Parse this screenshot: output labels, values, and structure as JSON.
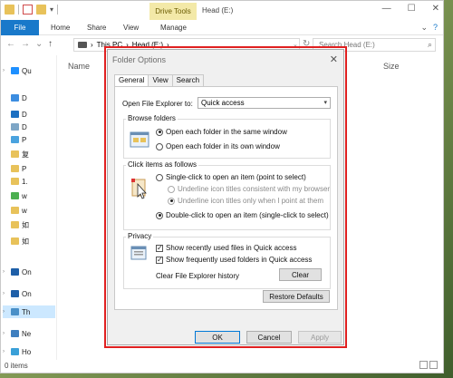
{
  "explorer": {
    "context_tab": "Drive Tools",
    "window_title": "Head (E:)",
    "window_controls": [
      "—",
      "☐",
      "✕"
    ],
    "ribbon_tabs": [
      "File",
      "Home",
      "Share",
      "View",
      "Manage"
    ],
    "breadcrumb": [
      "This PC",
      "Head (E:)"
    ],
    "search_placeholder": "Search Head (E:)",
    "columns": {
      "name": "Name",
      "size": "Size"
    },
    "nav_items": [
      {
        "label": "Qu",
        "icon": "star-icon",
        "color": "#1e90ff"
      },
      {
        "label": "D",
        "icon": "desktop-icon",
        "color": "#3c8de0"
      },
      {
        "label": "D",
        "icon": "download-icon",
        "color": "#1b6fc2"
      },
      {
        "label": "D",
        "icon": "documents-icon",
        "color": "#7ea6c6"
      },
      {
        "label": "P",
        "icon": "pictures-icon",
        "color": "#4aa3df"
      },
      {
        "label": "复",
        "icon": "folder-icon",
        "color": "#e8c25a"
      },
      {
        "label": "P",
        "icon": "folder-icon",
        "color": "#e8c25a"
      },
      {
        "label": "1.",
        "icon": "folder-icon",
        "color": "#e8c25a"
      },
      {
        "label": "w",
        "icon": "folder-icon",
        "color": "#4caf50"
      },
      {
        "label": "w",
        "icon": "folder-icon",
        "color": "#e8c25a"
      },
      {
        "label": "如",
        "icon": "folder-icon",
        "color": "#e8c25a"
      },
      {
        "label": "如",
        "icon": "folder-icon",
        "color": "#e8c25a"
      },
      {
        "label": "On",
        "icon": "onedrive-icon",
        "color": "#1e5fa8"
      },
      {
        "label": "On",
        "icon": "onedrive-icon",
        "color": "#1e5fa8"
      },
      {
        "label": "Th",
        "icon": "computer-icon",
        "color": "#4a90c8"
      },
      {
        "label": "Ne",
        "icon": "network-icon",
        "color": "#3f7fbf"
      },
      {
        "label": "Ho",
        "icon": "homegroup-icon",
        "color": "#3aa0d8"
      }
    ],
    "status": "0 items"
  },
  "dialog": {
    "title": "Folder Options",
    "tabs": [
      "General",
      "View",
      "Search"
    ],
    "open_label": "Open File Explorer to:",
    "open_value": "Quick access",
    "browse": {
      "title": "Browse folders",
      "options": [
        "Open each folder in the same window",
        "Open each folder in its own window"
      ]
    },
    "click": {
      "title": "Click items as follows",
      "single": "Single-click to open an item (point to select)",
      "underline_consistent": "Underline icon titles consistent with my browser",
      "underline_point": "Underline icon titles only when I point at them",
      "double": "Double-click to open an item (single-click to select)"
    },
    "privacy": {
      "title": "Privacy",
      "recent_files": "Show recently used files in Quick access",
      "frequent_folders": "Show frequently used folders in Quick access",
      "clear_label": "Clear File Explorer history",
      "clear_button": "Clear"
    },
    "restore_button": "Restore Defaults",
    "ok_button": "OK",
    "cancel_button": "Cancel",
    "apply_button": "Apply"
  },
  "colors": {
    "accent": "#1979ca",
    "highlight": "#e02020",
    "context_tab": "#f3e9a8"
  }
}
